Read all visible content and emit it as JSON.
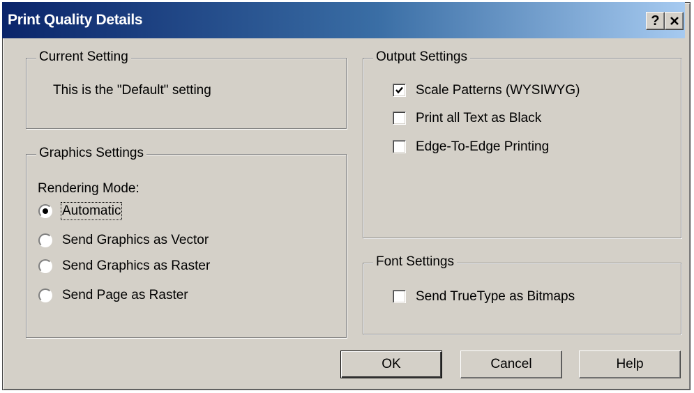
{
  "window": {
    "title": "Print Quality Details",
    "help_icon": "question-mark-icon",
    "close_icon": "close-icon"
  },
  "current_setting": {
    "legend": "Current Setting",
    "text": "This is the \"Default\" setting"
  },
  "graphics_settings": {
    "legend": "Graphics Settings",
    "rendering_label": "Rendering Mode:",
    "options": [
      {
        "label": "Automatic",
        "selected": true
      },
      {
        "label": "Send Graphics as Vector",
        "selected": false
      },
      {
        "label": "Send Graphics as Raster",
        "selected": false
      },
      {
        "label": "Send Page as Raster",
        "selected": false
      }
    ]
  },
  "output_settings": {
    "legend": "Output Settings",
    "options": [
      {
        "label": "Scale Patterns (WYSIWYG)",
        "checked": true
      },
      {
        "label": "Print all Text as Black",
        "checked": false
      },
      {
        "label": "Edge-To-Edge Printing",
        "checked": false
      }
    ]
  },
  "font_settings": {
    "legend": "Font Settings",
    "options": [
      {
        "label": "Send TrueType as Bitmaps",
        "checked": false
      }
    ]
  },
  "buttons": {
    "ok": "OK",
    "cancel": "Cancel",
    "help": "Help"
  }
}
